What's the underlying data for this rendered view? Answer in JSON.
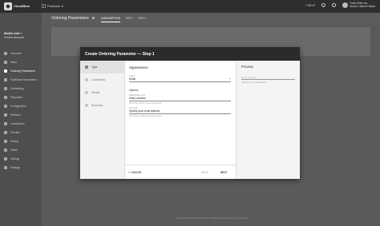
{
  "topbar": {
    "logo_text": "CloudBlue",
    "products_label": "Products",
    "help_label": "HELP",
    "user_name": "Frank Shine Inc.",
    "user_sub": "Vendor / Admin Hallow"
  },
  "sidebar": {
    "account_name": "Mobile Add",
    "account_sub": "Vendor account",
    "items": [
      {
        "label": "Overview",
        "icon": "home-icon",
        "active": false
      },
      {
        "label": "Items",
        "icon": "box-icon",
        "active": false
      },
      {
        "label": "Ordering Parameters",
        "icon": "list-icon",
        "active": true
      },
      {
        "label": "Fulfillment Parameters",
        "icon": "tasks-icon",
        "active": false
      },
      {
        "label": "Embedding",
        "icon": "code-icon",
        "active": false
      },
      {
        "label": "Templates",
        "icon": "file-icon",
        "active": false
      },
      {
        "label": "Configuration",
        "icon": "cog-icon",
        "active": false
      },
      {
        "label": "Versions",
        "icon": "layers-icon",
        "active": false
      },
      {
        "label": "Localization",
        "icon": "globe-icon",
        "active": false
      },
      {
        "label": "Preview",
        "icon": "eye-icon",
        "active": false
      },
      {
        "label": "Pricing",
        "icon": "dollar-icon",
        "active": false
      },
      {
        "label": "Offers",
        "icon": "tag-icon",
        "active": false
      },
      {
        "label": "Listings",
        "icon": "store-icon",
        "active": false
      },
      {
        "label": "Settings",
        "icon": "settings-icon",
        "active": false
      }
    ]
  },
  "header": {
    "title": "Ordering Parameters",
    "tabs": [
      {
        "label": "SUBSCRIPTION",
        "active": true
      },
      {
        "label": "TIER 1",
        "active": false
      },
      {
        "label": "TIER 2",
        "active": false
      }
    ]
  },
  "modal": {
    "title": "Create Ordering Parameter — Step 1",
    "steps": [
      {
        "num": "1",
        "label": "Type",
        "active": true
      },
      {
        "num": "2",
        "label": "Constraints",
        "active": false
      },
      {
        "num": "3",
        "label": "Details",
        "active": false
      },
      {
        "num": "4",
        "label": "Summary",
        "active": false
      }
    ],
    "appearance_title": "Appearance",
    "type_label": "Type*",
    "type_value": "Email",
    "options_title": "Options",
    "placeholder_label": "Placeholder text",
    "placeholder_value": "email_address",
    "placeholder_hint": "Text to be shown in the empty field",
    "hint_label": "Hint text",
    "hint_value": "Specify your email address",
    "hint_hint": "Text shown under the field as a hint",
    "preview_title": "Preview",
    "preview_placeholder": "email_address",
    "preview_hint": "Specify your email address",
    "cancel_label": "CANCEL",
    "back_label": "BACK",
    "next_label": "NEXT"
  },
  "copyright": "Copyright © CloudBlue Connect 2019 • All rights reserved. • Privacy • Terms of Service"
}
